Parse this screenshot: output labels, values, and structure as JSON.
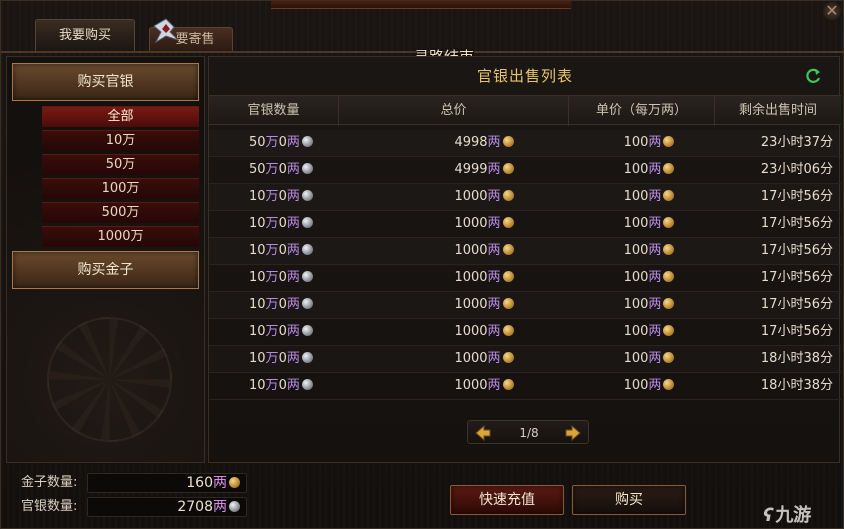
{
  "window": {
    "close_glyph": "✕"
  },
  "tabs": {
    "buy_label": "我要购买",
    "sell_label": "要寄售"
  },
  "path_notice": "寻路结束",
  "left": {
    "buy_silver": "购买官银",
    "amounts": [
      "全部",
      "10万",
      "50万",
      "100万",
      "500万",
      "1000万"
    ],
    "buy_gold": "购买金子"
  },
  "list": {
    "title": "官银出售列表",
    "refresh_icon": "refresh-icon",
    "headers": [
      "官银数量",
      "总价",
      "单价（每万两）",
      "剩余出售时间"
    ],
    "rows": [
      {
        "qty_num": "50",
        "qty_unit1": "万",
        "qty_zero": "0",
        "qty_unit2": "两",
        "total": "4998",
        "total_unit": "两",
        "unit": "100",
        "unit_unit": "两",
        "time": "23小时37分"
      },
      {
        "qty_num": "50",
        "qty_unit1": "万",
        "qty_zero": "0",
        "qty_unit2": "两",
        "total": "4999",
        "total_unit": "两",
        "unit": "100",
        "unit_unit": "两",
        "time": "23小时06分"
      },
      {
        "qty_num": "10",
        "qty_unit1": "万",
        "qty_zero": "0",
        "qty_unit2": "两",
        "total": "1000",
        "total_unit": "两",
        "unit": "100",
        "unit_unit": "两",
        "time": "17小时56分"
      },
      {
        "qty_num": "10",
        "qty_unit1": "万",
        "qty_zero": "0",
        "qty_unit2": "两",
        "total": "1000",
        "total_unit": "两",
        "unit": "100",
        "unit_unit": "两",
        "time": "17小时56分"
      },
      {
        "qty_num": "10",
        "qty_unit1": "万",
        "qty_zero": "0",
        "qty_unit2": "两",
        "total": "1000",
        "total_unit": "两",
        "unit": "100",
        "unit_unit": "两",
        "time": "17小时56分"
      },
      {
        "qty_num": "10",
        "qty_unit1": "万",
        "qty_zero": "0",
        "qty_unit2": "两",
        "total": "1000",
        "total_unit": "两",
        "unit": "100",
        "unit_unit": "两",
        "time": "17小时56分"
      },
      {
        "qty_num": "10",
        "qty_unit1": "万",
        "qty_zero": "0",
        "qty_unit2": "两",
        "total": "1000",
        "total_unit": "两",
        "unit": "100",
        "unit_unit": "两",
        "time": "17小时56分"
      },
      {
        "qty_num": "10",
        "qty_unit1": "万",
        "qty_zero": "0",
        "qty_unit2": "两",
        "total": "1000",
        "total_unit": "两",
        "unit": "100",
        "unit_unit": "两",
        "time": "17小时56分"
      },
      {
        "qty_num": "10",
        "qty_unit1": "万",
        "qty_zero": "0",
        "qty_unit2": "两",
        "total": "1000",
        "total_unit": "两",
        "unit": "100",
        "unit_unit": "两",
        "time": "18小时38分"
      },
      {
        "qty_num": "10",
        "qty_unit1": "万",
        "qty_zero": "0",
        "qty_unit2": "两",
        "total": "1000",
        "total_unit": "两",
        "unit": "100",
        "unit_unit": "两",
        "time": "18小时38分"
      }
    ]
  },
  "pager": {
    "page": "1/8"
  },
  "stats": {
    "gold_label": "金子数量:",
    "gold_value": "160",
    "gold_unit": "两",
    "silver_label": "官银数量:",
    "silver_value": "2708",
    "silver_unit": "两"
  },
  "buttons": {
    "recharge": "快速充值",
    "buy": "购买"
  },
  "watermark": "九游"
}
